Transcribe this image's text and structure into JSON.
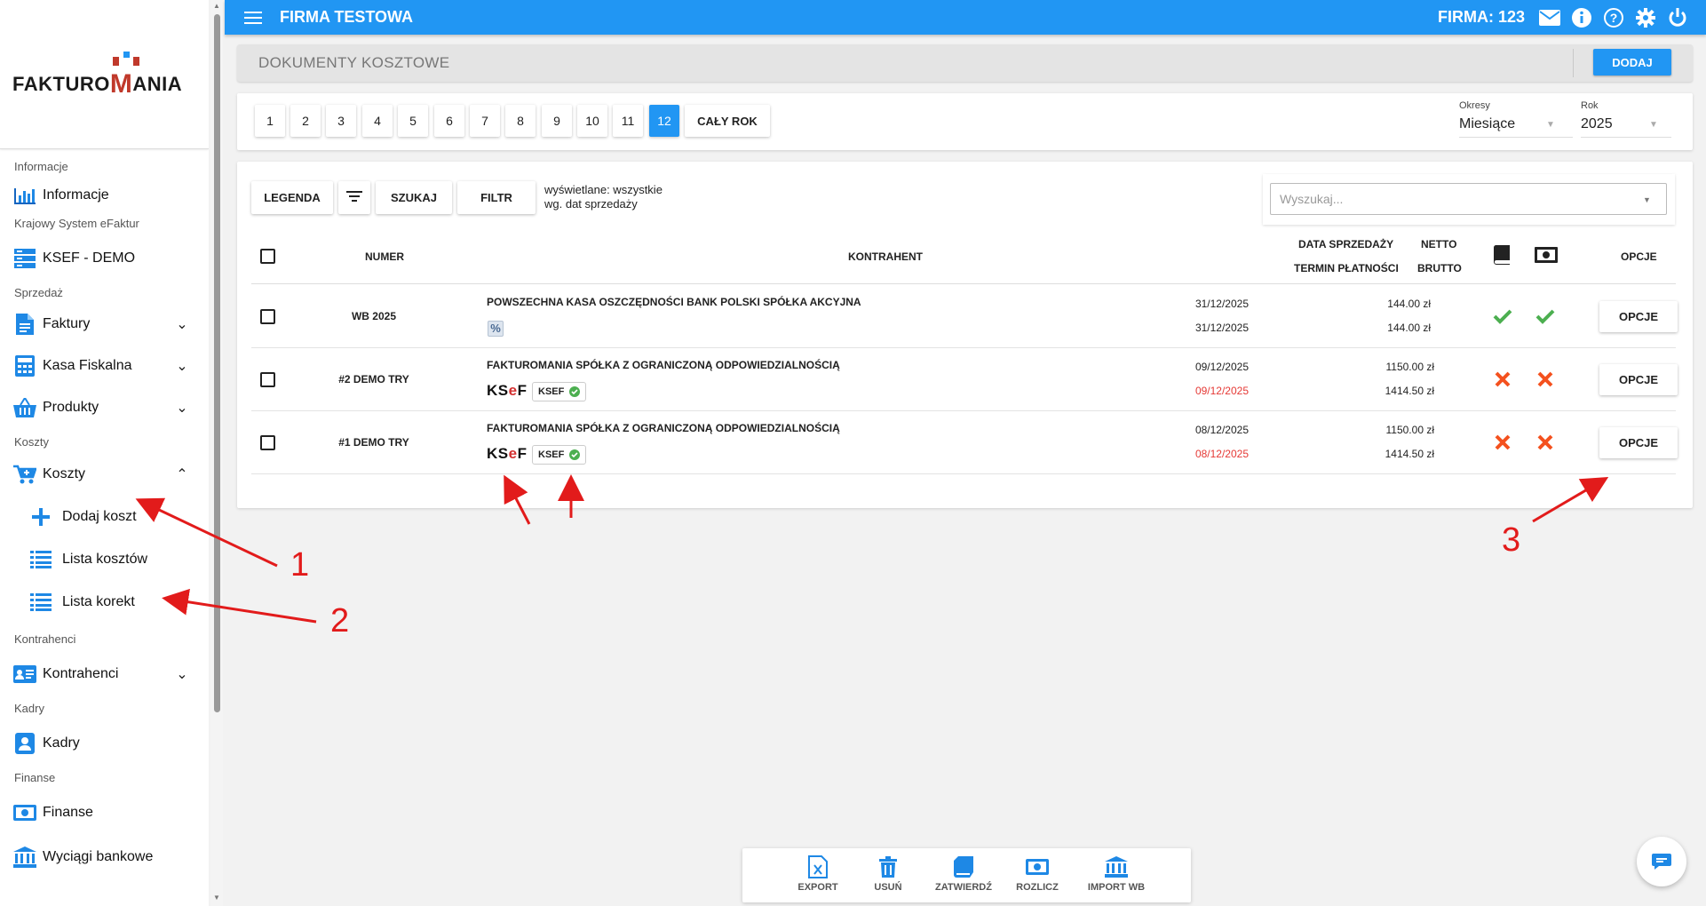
{
  "logo": {
    "text_left": "FAKTURO",
    "text_m": "M",
    "text_right": "ANIA"
  },
  "sidebar": {
    "sections": [
      {
        "title": "Informacje",
        "items": [
          {
            "label": "Informacje",
            "icon": "bar-chart-icon"
          }
        ]
      },
      {
        "title": "Krajowy System eFaktur",
        "items": [
          {
            "label": "KSEF - DEMO",
            "icon": "server-icon"
          }
        ]
      },
      {
        "title": "Sprzedaż",
        "items": [
          {
            "label": "Faktury",
            "icon": "document-icon"
          },
          {
            "label": "Kasa Fiskalna",
            "icon": "calculator-icon"
          },
          {
            "label": "Produkty",
            "icon": "basket-icon"
          }
        ]
      },
      {
        "title": "Koszty",
        "items": [
          {
            "label": "Koszty",
            "icon": "cart-icon"
          }
        ]
      },
      {
        "title": "Kontrahenci",
        "items": [
          {
            "label": "Kontrahenci",
            "icon": "contact-card-icon"
          }
        ]
      },
      {
        "title": "Kadry",
        "items": [
          {
            "label": "Kadry",
            "icon": "person-badge-icon"
          }
        ]
      },
      {
        "title": "Finanse",
        "items": [
          {
            "label": "Finanse",
            "icon": "banknote-icon"
          },
          {
            "label": "Wyciągi bankowe",
            "icon": "bank-icon"
          }
        ]
      }
    ],
    "submenu": [
      {
        "label": "Dodaj koszt",
        "icon": "plus-icon"
      },
      {
        "label": "Lista kosztów",
        "icon": "list-icon"
      },
      {
        "label": "Lista korekt",
        "icon": "list-icon"
      }
    ]
  },
  "topbar": {
    "title": "FIRMA TESTOWA",
    "company": "FIRMA: 123"
  },
  "header": {
    "title": "DOKUMENTY KOSZTOWE",
    "add_label": "DODAJ"
  },
  "months": {
    "items": [
      "1",
      "2",
      "3",
      "4",
      "5",
      "6",
      "7",
      "8",
      "9",
      "10",
      "11",
      "12"
    ],
    "active": "12",
    "whole_year": "CAŁY ROK"
  },
  "filters": {
    "period_label": "Okresy",
    "period_value": "Miesiące",
    "year_label": "Rok",
    "year_value": "2025"
  },
  "toolbar": {
    "legend": "LEGENDA",
    "search": "SZUKAJ",
    "filter": "FILTR",
    "info_line1": "wyświetlane: wszystkie",
    "info_line2": "wg. dat sprzedaży",
    "search_placeholder": "Wyszukaj..."
  },
  "table": {
    "headers": {
      "number": "NUMER",
      "contractor": "KONTRAHENT",
      "sale_date": "DATA SPRZEDAŻY",
      "due_date": "TERMIN PŁATNOŚCI",
      "net": "NETTO",
      "gross": "BRUTTO",
      "options": "OPCJE"
    },
    "rows": [
      {
        "number": "WB 2025",
        "contractor": "POWSZECHNA KASA OSZCZĘDNOŚCI BANK POLSKI SPÓŁKA AKCYJNA",
        "sale_date": "31/12/2025",
        "due_date": "31/12/2025",
        "due_overdue": false,
        "net": "144.00 zł",
        "gross": "144.00 zł",
        "booked": true,
        "paid": true,
        "ksef": false,
        "options": "OPCJE"
      },
      {
        "number": "#2 DEMO TRY",
        "contractor": "FAKTUROMANIA SPÓŁKA Z OGRANICZONĄ ODPOWIEDZIALNOŚCIĄ",
        "sale_date": "09/12/2025",
        "due_date": "09/12/2025",
        "due_overdue": true,
        "net": "1150.00 zł",
        "gross": "1414.50 zł",
        "booked": false,
        "paid": false,
        "ksef": true,
        "ksef_badge": "KSEF",
        "options": "OPCJE"
      },
      {
        "number": "#1 DEMO TRY",
        "contractor": "FAKTUROMANIA SPÓŁKA Z OGRANICZONĄ ODPOWIEDZIALNOŚCIĄ",
        "sale_date": "08/12/2025",
        "due_date": "08/12/2025",
        "due_overdue": true,
        "net": "1150.00 zł",
        "gross": "1414.50 zł",
        "booked": false,
        "paid": false,
        "ksef": true,
        "ksef_badge": "KSEF",
        "options": "OPCJE"
      }
    ]
  },
  "ksef_logo": {
    "k": "KS",
    "e": "e",
    "f": "F"
  },
  "bottom_bar": [
    {
      "label": "EXPORT",
      "icon": "excel-file-icon"
    },
    {
      "label": "USUŃ",
      "icon": "trash-icon"
    },
    {
      "label": "ZATWIERDŹ",
      "icon": "book-icon"
    },
    {
      "label": "ROZLICZ",
      "icon": "banknote-icon"
    },
    {
      "label": "IMPORT WB",
      "icon": "bank-icon"
    }
  ],
  "annotations": [
    "1",
    "2",
    "3"
  ],
  "colors": {
    "primary": "#2196f3",
    "danger": "#e53935",
    "success": "#4caf50",
    "annotation": "#e21b1b",
    "cross": "#f4511e"
  }
}
